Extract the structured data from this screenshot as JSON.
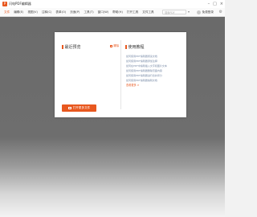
{
  "app": {
    "logo_text": "P",
    "title": "闪电PDF编辑器"
  },
  "window_controls": [
    "–",
    "□",
    "×"
  ],
  "menu": {
    "items": [
      "文件",
      "编辑(E)",
      "视图(V)",
      "注释(C)",
      "表单(O)",
      "页面(P)",
      "工具(T)",
      "窗口(W)",
      "帮助(H)",
      "打开工具",
      "文件工具"
    ],
    "active_index": 0,
    "search_placeholder": "搜索PDF",
    "login_label": "免费登录",
    "settings_icon": "gear-icon"
  },
  "start_page": {
    "recent_title": "最近预览",
    "clear_label": "清除",
    "help_title": "使用教程",
    "help_items": [
      "如何使用PDF编辑器阅读文档",
      "如何使用PDF编辑器添加注释",
      "如何在PDF中编辑插入文字和图片文本",
      "如何使用PDF编辑器删除页面内容",
      "如何使用PDF编辑器进行合并拆分",
      "如何使用PDF编辑器编辑文档"
    ],
    "more_label": "查看更多 >",
    "open_button_label": "打开更多文件"
  },
  "colors": {
    "accent": "#e8581f",
    "workspace": "#6e6e6e",
    "link": "#7a8ca8"
  }
}
